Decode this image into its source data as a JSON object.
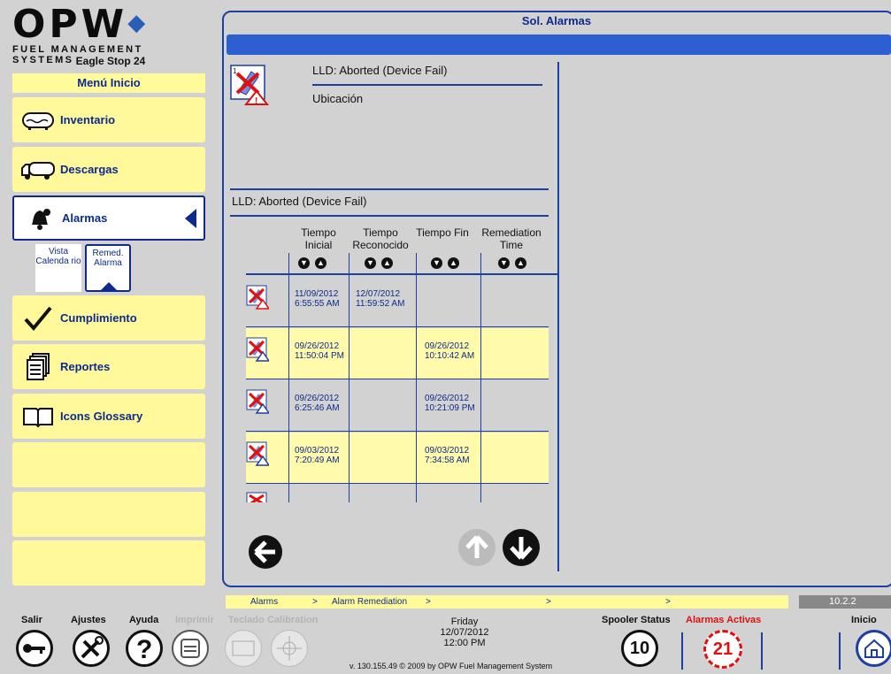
{
  "brand": {
    "logo": "OPW",
    "subtitle": "FUEL MANAGEMENT SYSTEMS"
  },
  "station": "Eagle Stop 24",
  "menu": {
    "header": "Menú Inicio",
    "items": [
      {
        "label": "Inventario",
        "icon": "tank-icon"
      },
      {
        "label": "Descargas",
        "icon": "truck-icon"
      },
      {
        "label": "Alarmas",
        "icon": "bell-icon",
        "active": true
      },
      {
        "label": "Cumplimiento",
        "icon": "checkmark-icon"
      },
      {
        "label": "Reportes",
        "icon": "reports-icon"
      },
      {
        "label": "Icons Glossary",
        "icon": "book-icon"
      }
    ],
    "subtabs": [
      {
        "label": "Vista Calenda rio"
      },
      {
        "label": "Remed. Alarma",
        "selected": true
      }
    ]
  },
  "panel": {
    "title": "Sol. Alarmas",
    "alarm_title": "LLD: Aborted (Device Fail)",
    "location_label": "Ubicación",
    "section_title": "LLD: Aborted (Device Fail)",
    "columns": [
      "Tiempo Inicial",
      "Tiempo Reconocido",
      "Tiempo Fin",
      "Remediation Time"
    ],
    "rows": [
      {
        "start_date": "11/09/2012",
        "start_time": "6:55:55 AM",
        "ack_date": "12/07/2012",
        "ack_time": "11:59:52 AM",
        "end_date": "",
        "end_time": "",
        "highlight": false,
        "warn_color": "#e01010"
      },
      {
        "start_date": "09/26/2012",
        "start_time": "11:50:04 PM",
        "ack_date": "",
        "ack_time": "",
        "end_date": "09/26/2012",
        "end_time": "10:10:42 AM",
        "highlight": true,
        "warn_color": "#ffffff"
      },
      {
        "start_date": "09/26/2012",
        "start_time": "6:25:46 AM",
        "ack_date": "",
        "ack_time": "",
        "end_date": "09/26/2012",
        "end_time": "10:21:09 PM",
        "highlight": false,
        "warn_color": "#ffffff"
      },
      {
        "start_date": "09/03/2012",
        "start_time": "7:20:49 AM",
        "ack_date": "",
        "ack_time": "",
        "end_date": "09/03/2012",
        "end_time": "7:34:58 AM",
        "highlight": true,
        "warn_color": "#ffffff"
      }
    ]
  },
  "breadcrumb": [
    "Alarms",
    ">",
    "Alarm Remediation",
    ">",
    ">",
    ">"
  ],
  "version": "10.2.2",
  "bottom": {
    "salir": "Salir",
    "ajustes": "Ajustes",
    "ayuda": "Ayuda",
    "imprimir": "Imprimir",
    "teclado": "Teclado",
    "calibration": "Calibration",
    "day": "Friday",
    "date": "12/07/2012",
    "time": "12:00 PM",
    "copyright": "v. 130.155.49   © 2009 by OPW Fuel Management System",
    "spooler_label": "Spooler Status",
    "spooler_count": "10",
    "alarms_label": "Alarmas Activas",
    "alarms_count": "21",
    "inicio": "Inicio"
  },
  "colors": {
    "accent": "#0d2a8c",
    "bar": "#2e5fd0",
    "menu_bg": "#fff99c",
    "alert": "#e01010"
  }
}
